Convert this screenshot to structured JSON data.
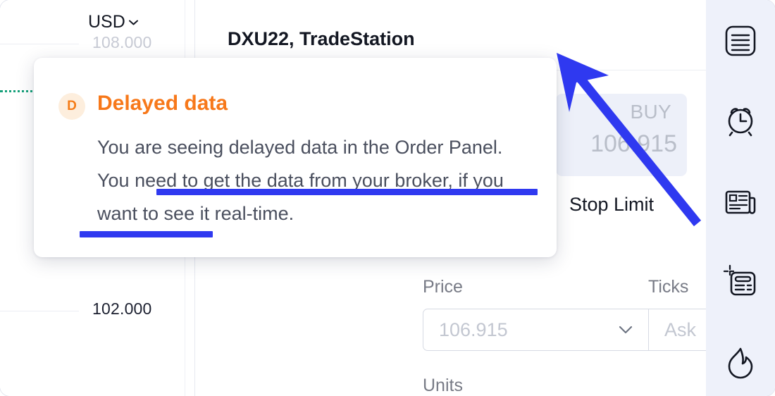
{
  "chart": {
    "currency": "USD",
    "currency_icon": "chevron-down-icon",
    "price_labels": [
      {
        "value": "108.000",
        "faded": true
      },
      {
        "value": "102.000",
        "faded": false
      }
    ],
    "level_line_color": "#16a07a"
  },
  "order_panel": {
    "title": "DXU22, TradeStation",
    "delayed_badge_letter": "D",
    "more_icon": "more-horizontal-icon",
    "close_icon": "close-icon",
    "buy": {
      "label": "BUY",
      "price": "106.915"
    },
    "order_type": "Stop Limit",
    "fields": {
      "price_label": "Price",
      "price_value": "106.915",
      "ticks_label": "Ticks",
      "ticks_value": "Ask",
      "units_label": "Units"
    }
  },
  "tooltip": {
    "badge_letter": "D",
    "title": "Delayed data",
    "body": "You are seeing delayed data in the Order Panel. You need to get the data from your broker, if you want to see it real-time."
  },
  "sidebar": {
    "items": [
      {
        "icon": "watchlist-icon"
      },
      {
        "icon": "alert-clock-icon"
      },
      {
        "icon": "news-icon"
      },
      {
        "icon": "data-window-icon"
      },
      {
        "icon": "hotlist-flame-icon"
      }
    ]
  },
  "annotation": {
    "color": "#2f39f0",
    "arrow_from": "bottom-right",
    "arrow_to": "delayed-data-badge"
  }
}
